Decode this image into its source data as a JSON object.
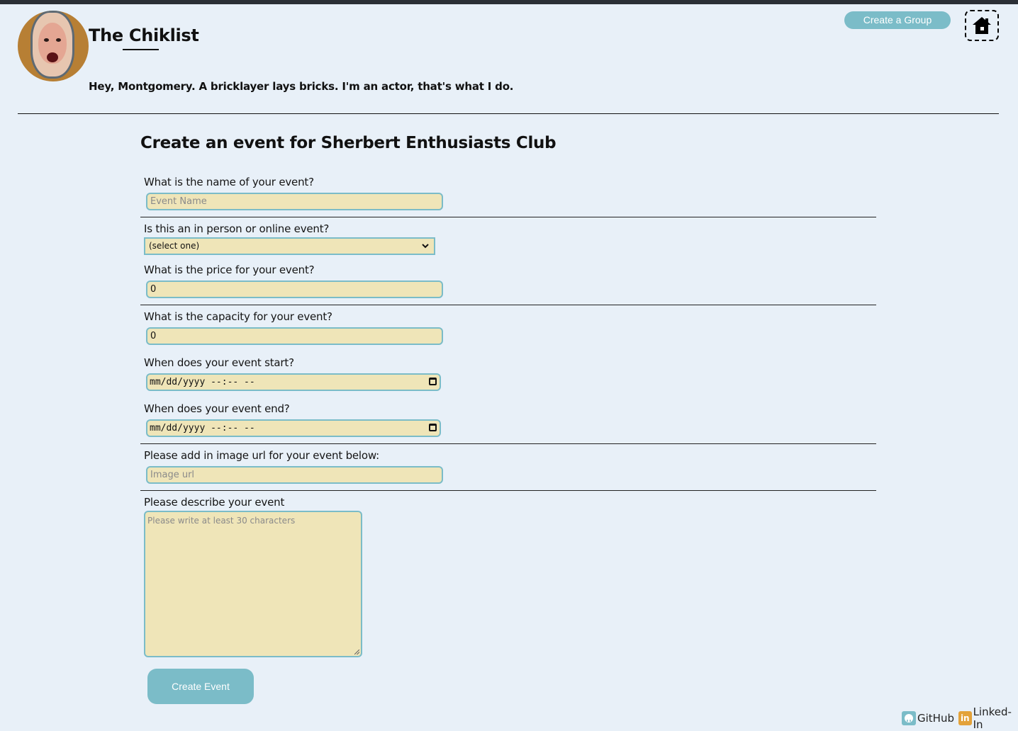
{
  "header": {
    "brand": "The Chiklist",
    "greeting": "Hey, Montgomery. A bricklayer lays bricks. I'm an actor, that's what I do.",
    "create_group_label": "Create a Group"
  },
  "form": {
    "title": "Create an event for Sherbert Enthusiasts Club",
    "name_label": "What is the name of your event?",
    "name_placeholder": "Event Name",
    "type_label": "Is this an in person or online event?",
    "type_selected": "(select one)",
    "price_label": "What is the price for your event?",
    "price_value": "0",
    "capacity_label": "What is the capacity for your event?",
    "capacity_value": "0",
    "start_label": "When does your event start?",
    "start_value": "mm/dd/yyyy --:-- --",
    "end_label": "When does your event end?",
    "end_value": "mm/dd/yyyy --:-- --",
    "image_label": "Please add in image url for your event below:",
    "image_placeholder": "Image url",
    "desc_label": "Please describe your event",
    "desc_placeholder": "Please write at least 30 characters",
    "submit_label": "Create Event"
  },
  "footer": {
    "github_label": "GitHub",
    "linkedin_label": "Linked-In",
    "linkedin_badge": "in"
  },
  "colors": {
    "page_bg": "#e8f0f8",
    "accent": "#7bbcc8",
    "field_bg": "#efe5b8"
  }
}
